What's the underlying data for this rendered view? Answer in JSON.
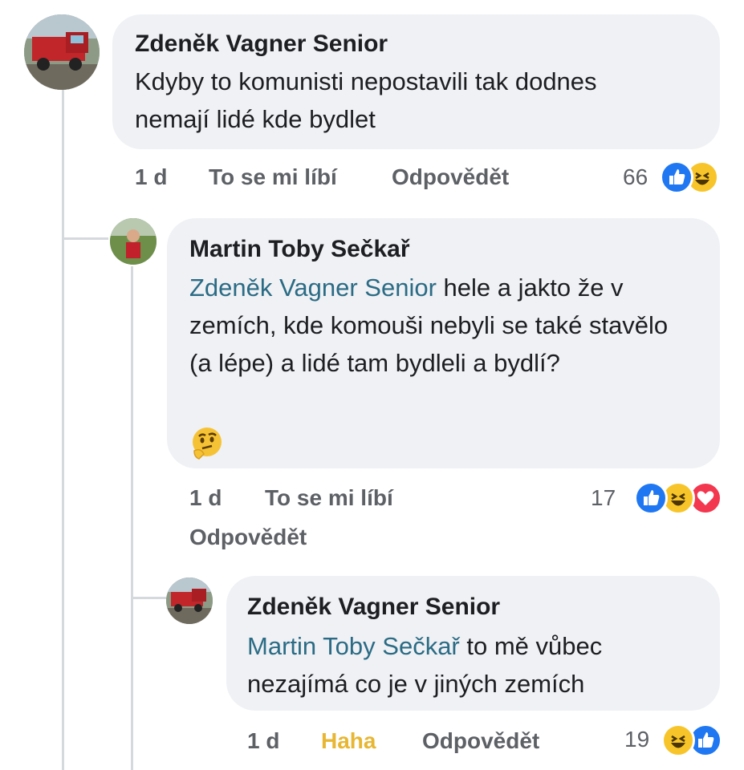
{
  "comments": [
    {
      "author": "Zdeněk Vagner Senior",
      "mention": "",
      "text": "Kdyby to komunisti nepostavili tak dodnes nemají lidé kde bydlet",
      "time": "1 d",
      "like_label": "To se mi líbí",
      "reply_label": "Odpovědět",
      "reaction_count": "66",
      "reactions": [
        "like-icon",
        "haha-icon"
      ]
    },
    {
      "author": "Martin Toby Sečkař",
      "mention": "Zdeněk Vagner Senior",
      "text": "hele a jakto že v zemích, kde komouši nebyli se také stavělo (a lépe) a lidé tam bydleli a bydlí?",
      "emoji": "thinking-face-emoji",
      "time": "1 d",
      "like_label": "To se mi líbí",
      "reply_label": "Odpovědět",
      "reaction_count": "17",
      "reactions": [
        "like-icon",
        "haha-icon",
        "love-icon"
      ]
    },
    {
      "author": "Zdeněk Vagner Senior",
      "mention": "Martin Toby Sečkař",
      "text": "to mě vůbec nezajímá co je v jiných zemích",
      "time": "1 d",
      "like_label": "Haha",
      "reply_label": "Odpovědět",
      "reaction_count": "19",
      "reactions": [
        "haha-icon",
        "like-icon"
      ]
    }
  ],
  "colors": {
    "bubble": "#eff1f4",
    "mention": "#2b6b85",
    "meta": "#5d6065",
    "haha_active": "#e7b633",
    "like": "#1f77f2",
    "love": "#f2374f"
  }
}
